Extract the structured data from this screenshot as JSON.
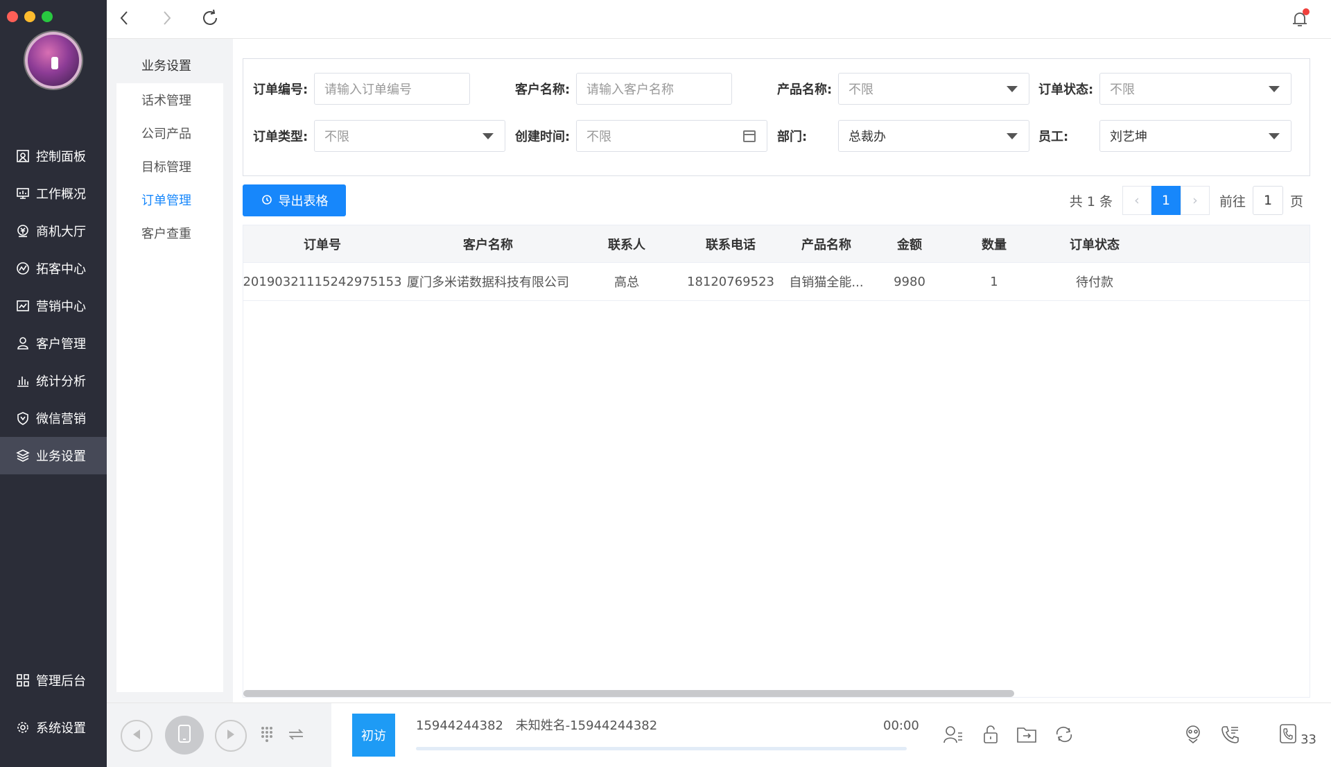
{
  "colors": {
    "accent": "#1787fb",
    "sidebar_bg": "#2b2d38",
    "active_nav": "#464957",
    "tag_blue": "#1e9bf5",
    "notify_dot": "#f0403c"
  },
  "window_controls": [
    "close",
    "minimize",
    "maximize"
  ],
  "sidebar": {
    "items": [
      {
        "label": "控制面板",
        "icon": "dashboard-icon"
      },
      {
        "label": "工作概况",
        "icon": "monitor-icon"
      },
      {
        "label": "商机大厅",
        "icon": "money-icon"
      },
      {
        "label": "拓客中心",
        "icon": "trend-icon"
      },
      {
        "label": "营销中心",
        "icon": "chart-icon"
      },
      {
        "label": "客户管理",
        "icon": "user-icon"
      },
      {
        "label": "统计分析",
        "icon": "bar-chart-icon"
      },
      {
        "label": "微信营销",
        "icon": "shield-icon"
      },
      {
        "label": "业务设置",
        "icon": "layers-icon",
        "active": true
      }
    ],
    "bottom_items": [
      {
        "label": "管理后台",
        "icon": "grid-icon"
      },
      {
        "label": "系统设置",
        "icon": "gear-icon"
      }
    ]
  },
  "submenu": {
    "header": "业务设置",
    "items": [
      {
        "label": "话术管理"
      },
      {
        "label": "公司产品"
      },
      {
        "label": "目标管理"
      },
      {
        "label": "订单管理",
        "active": true
      },
      {
        "label": "客户查重"
      }
    ]
  },
  "filters": {
    "order_no": {
      "label": "订单编号:",
      "placeholder": "请输入订单编号"
    },
    "customer": {
      "label": "客户名称:",
      "placeholder": "请输入客户名称"
    },
    "product": {
      "label": "产品名称:",
      "value": "不限"
    },
    "status": {
      "label": "订单状态:",
      "value": "不限"
    },
    "order_type": {
      "label": "订单类型:",
      "value": "不限"
    },
    "created": {
      "label": "创建时间:",
      "value": "不限"
    },
    "department": {
      "label": "部门:",
      "value": "总裁办"
    },
    "employee": {
      "label": "员工:",
      "value": "刘艺坤"
    }
  },
  "toolbar": {
    "export_label": "导出表格"
  },
  "pager": {
    "total": "共 1 条",
    "current": "1",
    "goto_label": "前往",
    "goto_value": "1",
    "page_suffix": "页"
  },
  "table": {
    "columns": [
      "订单号",
      "客户名称",
      "联系人",
      "联系电话",
      "产品名称",
      "金额",
      "数量",
      "订单状态"
    ],
    "rows": [
      [
        "20190321115242975153",
        "厦门多米诺数据科技有限公司",
        "高总",
        "18120769523",
        "自销猫全能...",
        "9980",
        "1",
        "待付款"
      ]
    ]
  },
  "callbar": {
    "tag": "初访",
    "number": "15944244382",
    "name": "未知姓名-15944244382",
    "time": "00:00",
    "count": "33"
  }
}
